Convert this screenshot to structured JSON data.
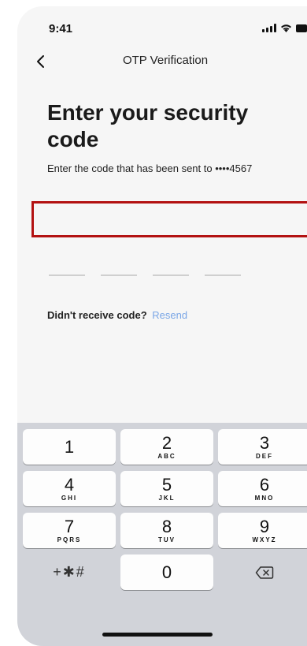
{
  "status_bar": {
    "time": "9:41"
  },
  "nav": {
    "title": "OTP Verification"
  },
  "content": {
    "headline": "Enter your security code",
    "subtext": "Enter the code that has been sent to ••••4567",
    "resend_prompt": "Didn't receive code?",
    "resend_link": "Resend"
  },
  "otp": {
    "digits": [
      "",
      "",
      "",
      ""
    ]
  },
  "keypad": {
    "keys": [
      {
        "num": "1",
        "letters": ""
      },
      {
        "num": "2",
        "letters": "ABC"
      },
      {
        "num": "3",
        "letters": "DEF"
      },
      {
        "num": "4",
        "letters": "GHI"
      },
      {
        "num": "5",
        "letters": "JKL"
      },
      {
        "num": "6",
        "letters": "MNO"
      },
      {
        "num": "7",
        "letters": "PQRS"
      },
      {
        "num": "8",
        "letters": "TUV"
      },
      {
        "num": "9",
        "letters": "WXYZ"
      },
      {
        "num": "0",
        "letters": ""
      }
    ],
    "symbols_label": "+✱#"
  },
  "colors": {
    "highlight_border": "#b31212",
    "link": "#7aa6e6",
    "keypad_bg": "#d1d3d9"
  }
}
